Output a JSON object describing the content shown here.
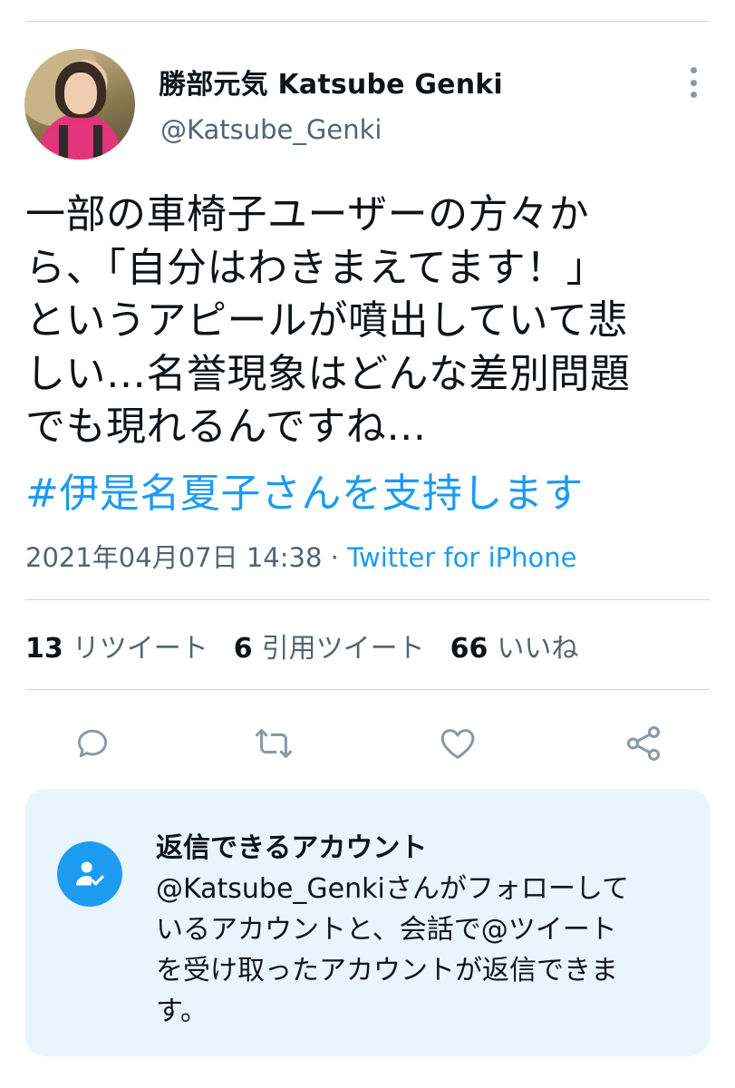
{
  "author": {
    "display_name": "勝部元気 Katsube Genki",
    "handle": "@Katsube_Genki",
    "avatar_icon": "profile-photo"
  },
  "tweet": {
    "text": "一部の車椅子ユーザーの方々か\nら、「自分はわきまえてます！」\nというアピールが噴出していて悲\nしい…名誉現象はどんな差別問題\nでも現れるんですね…",
    "hashtag": "#伊是名夏子さんを支持します",
    "timestamp": "2021年04月07日 14:38",
    "separator": " · ",
    "source": "Twitter for iPhone"
  },
  "stats": {
    "retweets": {
      "count": "13",
      "label": "リツイート"
    },
    "quotes": {
      "count": "6",
      "label": "引用ツイート"
    },
    "likes": {
      "count": "66",
      "label": "いいね"
    }
  },
  "actions": {
    "reply_icon": "reply-icon",
    "retweet_icon": "retweet-icon",
    "like_icon": "heart-icon",
    "share_icon": "share-icon"
  },
  "reply_notice": {
    "title": "返信できるアカウント",
    "body": "@Katsube_Genkiさんがフォローして\nいるアカウントと、会話で@ツイート\nを受け取ったアカウントが返信できま\nす。",
    "icon": "verified-user-icon"
  },
  "colors": {
    "accent": "#1d9bf0",
    "secondary_text": "#536471",
    "card_background": "#e8f5fd",
    "divider": "#cfd9de"
  }
}
